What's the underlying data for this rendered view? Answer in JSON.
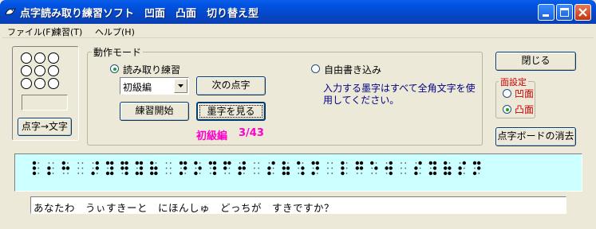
{
  "window": {
    "title": "点字読み取り練習ソフト　凹面　凸面　切り替え型"
  },
  "menu": {
    "file": "ファイル(F)",
    "practice": "練習(T)",
    "help": "ヘルプ(H)"
  },
  "left": {
    "braille_to_text": "点字→文字"
  },
  "mode": {
    "group_title": "動作モード",
    "read_practice": "読み取り練習",
    "free_write": "自由書き込み",
    "free_write_note": "入力する墨字はすべて全角文字を使用してください。",
    "level_selected": "初級編",
    "next_braille": "次の点字",
    "start_practice": "練習開始",
    "show_text": "墨字を見る",
    "progress_level": "初級編",
    "progress_count": "3/43",
    "read_practice_selected": true
  },
  "right": {
    "close": "閉じる",
    "surface_title": "面設定",
    "concave": "凹面",
    "convex": "凸面",
    "surface_selected": "convex",
    "clear_board": "点字ボードの消去"
  },
  "output_text": "あなたわ　うぃすきーと　にほんしゅ　どっちが　すきですか？",
  "colors": {
    "progress": "#ff00cc",
    "highlight": "#ff0000",
    "braille_bg": "#ccffff"
  },
  "braille_cells": [
    [
      1,
      0,
      1,
      0,
      1,
      0
    ],
    [
      0,
      0,
      1,
      0,
      1,
      0
    ],
    [
      1,
      0,
      1,
      1,
      0,
      0
    ],
    [
      0,
      0,
      0,
      0,
      0,
      0
    ],
    [
      0,
      1,
      0,
      1,
      1,
      0
    ],
    [
      1,
      1,
      0,
      1,
      1,
      1
    ],
    [
      1,
      1,
      1,
      1,
      0,
      1
    ],
    [
      1,
      1,
      0,
      1,
      1,
      1
    ],
    [
      1,
      0,
      1,
      1,
      1,
      1
    ],
    [
      0,
      0,
      0,
      0,
      0,
      0
    ],
    [
      1,
      1,
      0,
      1,
      1,
      0
    ],
    [
      1,
      0,
      0,
      1,
      1,
      0
    ],
    [
      1,
      1,
      0,
      1,
      0,
      1
    ],
    [
      1,
      1,
      1,
      0,
      0,
      0
    ],
    [
      0,
      1,
      1,
      1,
      1,
      0
    ],
    [
      0,
      0,
      0,
      0,
      0,
      0
    ],
    [
      0,
      1,
      1,
      0,
      1,
      0
    ],
    [
      1,
      0,
      1,
      1,
      1,
      1
    ],
    [
      1,
      0,
      0,
      1,
      0,
      1
    ],
    [
      1,
      1,
      0,
      1,
      1,
      0
    ],
    [
      0,
      0,
      0,
      0,
      0,
      0
    ],
    [
      1,
      0,
      1,
      0,
      1,
      0
    ],
    [
      1,
      1,
      1,
      1,
      0,
      0
    ],
    [
      1,
      0,
      0,
      1,
      0,
      0
    ],
    [
      0,
      1,
      1,
      1,
      0,
      1
    ],
    [
      0,
      0,
      0,
      0,
      0,
      0
    ],
    [
      0,
      1,
      1,
      0,
      1,
      0
    ],
    [
      1,
      1,
      0,
      1,
      1,
      1
    ],
    [
      1,
      0,
      1,
      1,
      1,
      1
    ],
    [
      0,
      1,
      1,
      0,
      1,
      0
    ],
    [
      1,
      1,
      0,
      1,
      1,
      0
    ]
  ]
}
